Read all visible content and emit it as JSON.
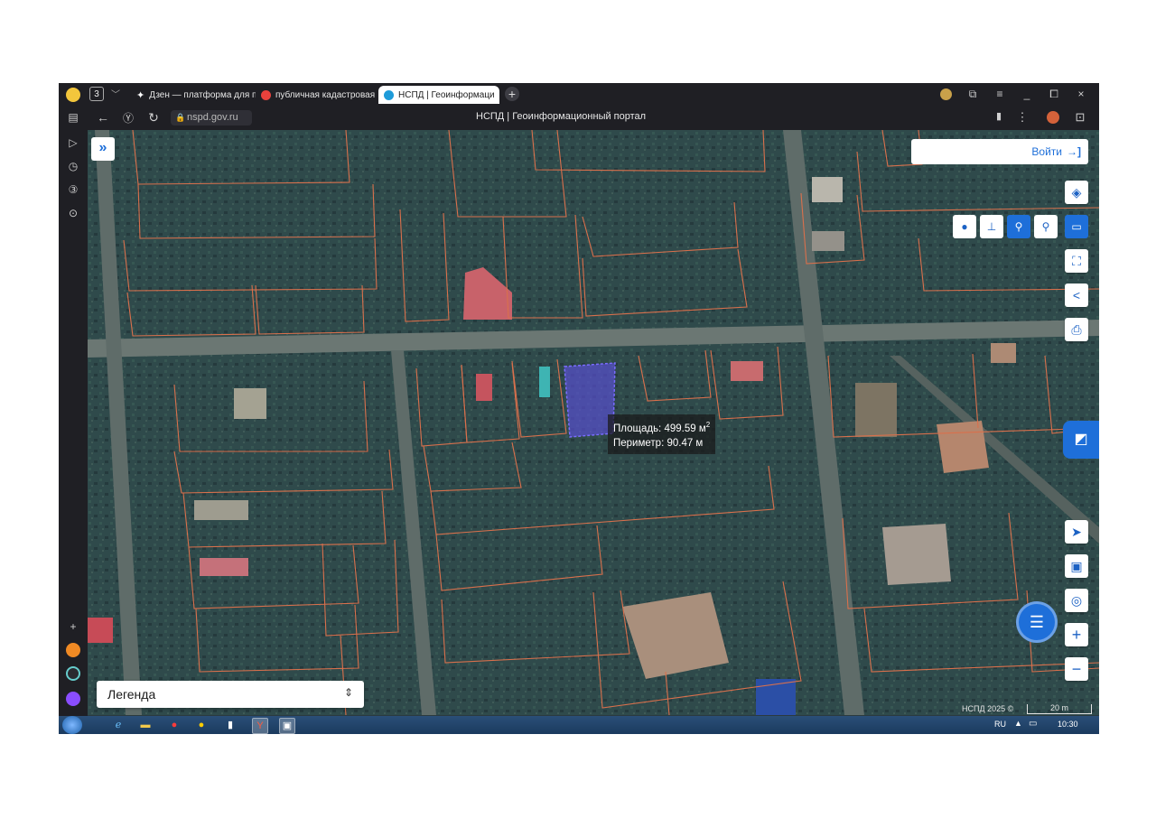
{
  "browser": {
    "tab_count": "3",
    "tabs": [
      {
        "label": "Дзен — платформа для п",
        "icon": "zen-star-icon",
        "active": false
      },
      {
        "label": "публичная кадастровая к",
        "icon": "yandex-icon",
        "active": false
      },
      {
        "label": "НСПД | Геоинформаци",
        "icon": "nspd-icon",
        "active": true
      }
    ],
    "address": "nspd.gov.ru",
    "page_title": "НСПД | Геоинформационный портал"
  },
  "map": {
    "login_label": "Войти",
    "tooltip": {
      "area_label": "Площадь: 499.59 м",
      "area_unit_sup": "2",
      "perimeter_label": "Периметр: 90.47 м"
    },
    "legend_label": "Легенда",
    "copyright": "НСПД 2025 ©",
    "scale_label": "20 m"
  },
  "taskbar": {
    "language": "RU",
    "clock": "10:30"
  },
  "colors": {
    "accent": "#1e6fd9",
    "parcel_border": "#d9704c",
    "selected_parcel": "#5a4fd8"
  },
  "icons": [
    "chevron-double-right-icon",
    "layers-icon",
    "point-icon",
    "corner-icon",
    "snap-icon",
    "snap-alt-icon",
    "ruler-icon",
    "area-select-icon",
    "share-icon",
    "print-icon",
    "locate-icon",
    "minimap-icon",
    "geo-icon",
    "zoom-in-icon",
    "zoom-out-icon",
    "chat-icon",
    "sidebar-logo-icon"
  ]
}
